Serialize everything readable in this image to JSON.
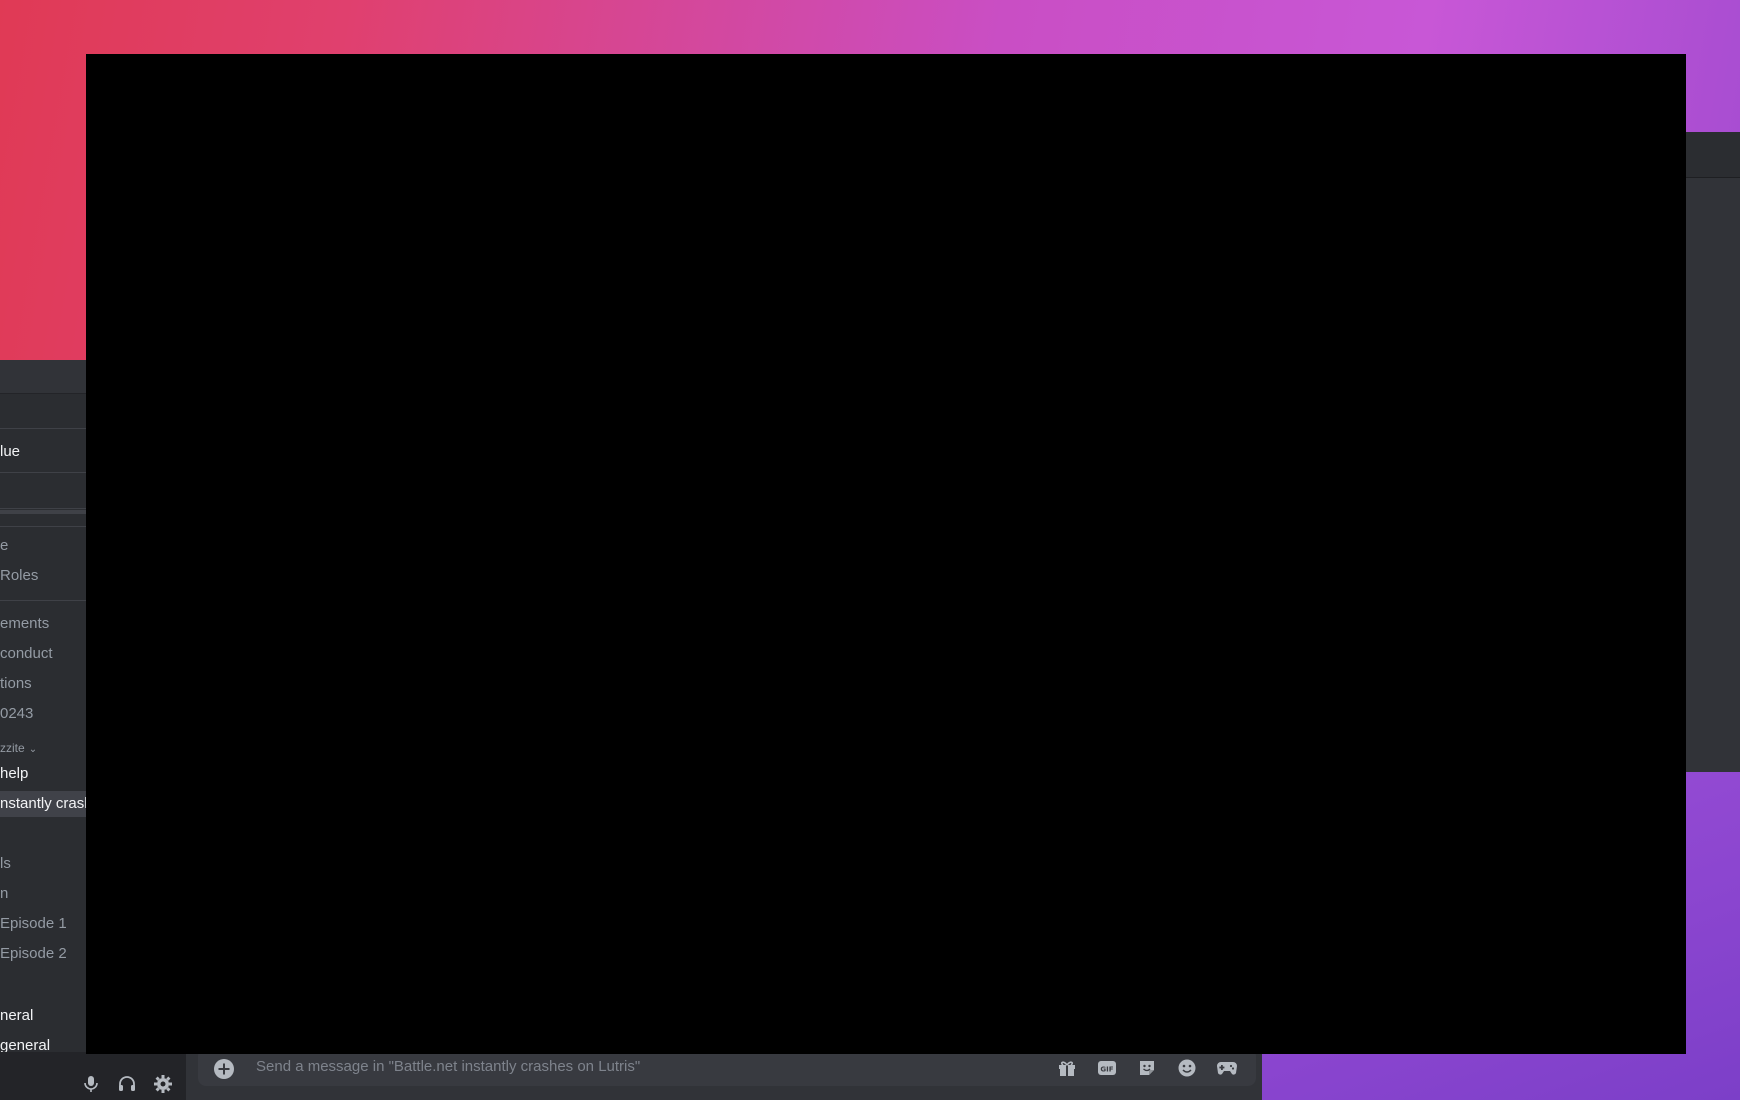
{
  "sidebar": {
    "items": [
      {
        "label": "lue",
        "style": "bright"
      },
      {
        "label": "e",
        "style": "dim"
      },
      {
        "label": "Roles",
        "style": "dim"
      },
      {
        "label": "ements",
        "style": "dim"
      },
      {
        "label": "conduct",
        "style": "dim"
      },
      {
        "label": "tions",
        "style": "dim"
      },
      {
        "label": "0243",
        "style": "dim"
      },
      {
        "label": "help",
        "style": "bright"
      },
      {
        "label": "nstantly crasl",
        "style": "selected"
      },
      {
        "label": "ls",
        "style": "dim"
      },
      {
        "label": "n",
        "style": "dim"
      },
      {
        "label": "Episode 1",
        "style": "dim"
      },
      {
        "label": "Episode 2",
        "style": "dim"
      },
      {
        "label": "neral",
        "style": "bright"
      },
      {
        "label": "general",
        "style": "bright"
      }
    ],
    "category": "zzite"
  },
  "user_panel": {
    "icons": [
      "microphone-icon",
      "headphones-icon",
      "gear-icon"
    ]
  },
  "composer": {
    "placeholder": "Send a message in \"Battle.net instantly crashes on Lutris\"",
    "buttons": [
      "gift-icon",
      "gif-icon",
      "sticker-icon",
      "emoji-icon",
      "activities-icon"
    ]
  },
  "colors": {
    "overlay": "#000000",
    "sidebar_bg": "#2b2d31",
    "chat_bg": "#313338",
    "composer_bg": "#383a40"
  }
}
